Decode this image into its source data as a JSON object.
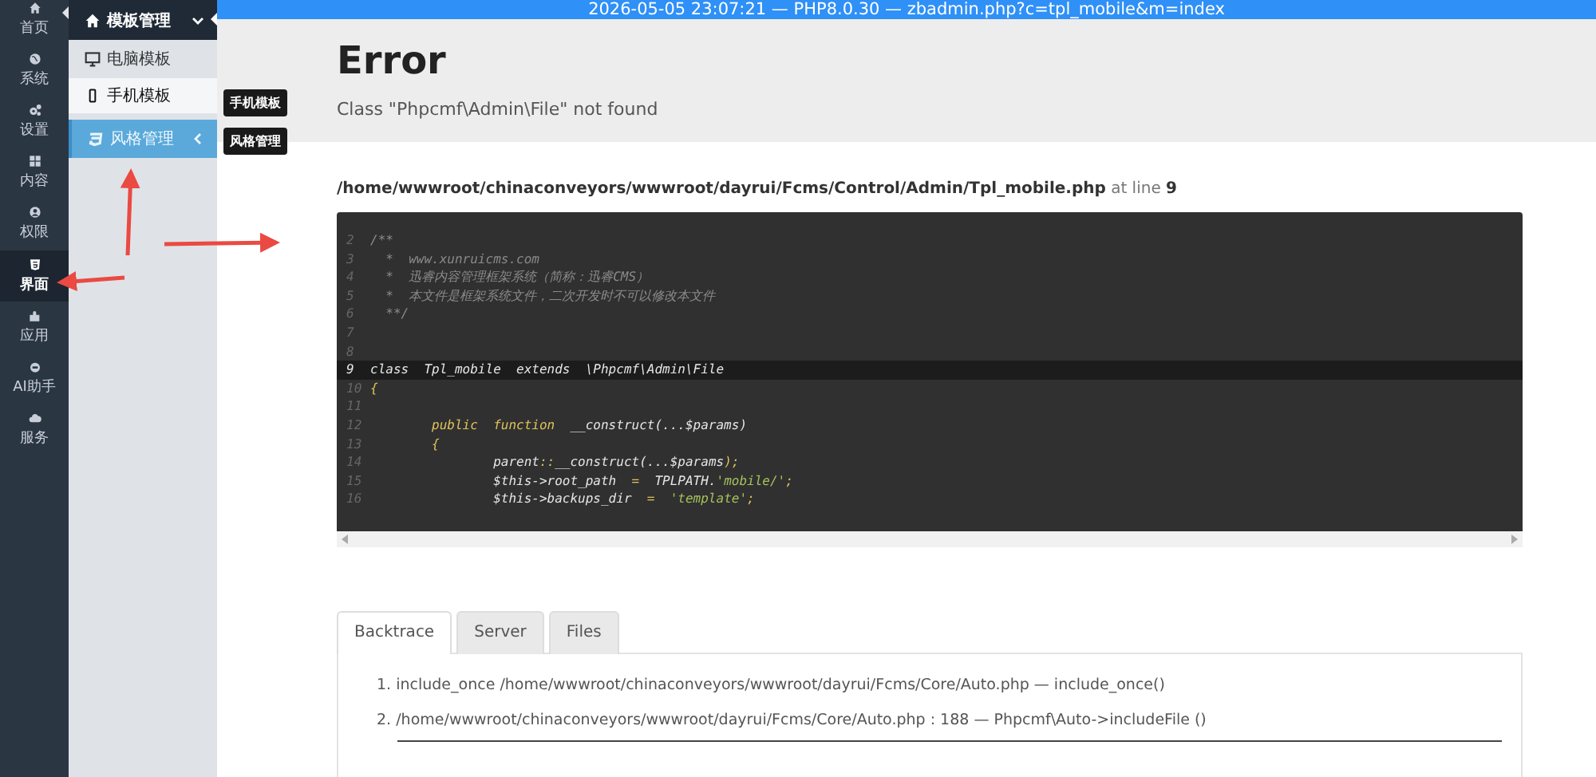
{
  "rail": [
    {
      "label": "首页",
      "selected": false
    },
    {
      "label": "系统",
      "selected": false
    },
    {
      "label": "设置",
      "selected": false
    },
    {
      "label": "内容",
      "selected": false
    },
    {
      "label": "权限",
      "selected": false
    },
    {
      "label": "界面",
      "selected": true
    },
    {
      "label": "应用",
      "selected": false
    },
    {
      "label": "AI助手",
      "selected": false
    },
    {
      "label": "服务",
      "selected": false
    }
  ],
  "submenu": [
    {
      "kind": "header",
      "label": "模板管理",
      "expanded": true
    },
    {
      "kind": "item",
      "label": "电脑模板",
      "selected": false
    },
    {
      "kind": "item",
      "label": "手机模板",
      "selected": true
    },
    {
      "kind": "group",
      "label": "风格管理",
      "expanded": false
    }
  ],
  "tooltips": [
    "手机模板",
    "风格管理"
  ],
  "top_bar": "2026-05-05 23:07:21 — PHP8.0.30 — zbadmin.php?c=tpl_mobile&m=index",
  "error": {
    "title": "Error",
    "message": "Class \"Phpcmf\\Admin\\File\" not found"
  },
  "location": {
    "file": "/home/wwwroot/chinaconveyors/wwwroot/dayrui/Fcms/Control/Admin/Tpl_mobile.php",
    "at": "at line",
    "line": "9"
  },
  "code_lines": [
    {
      "num": "2",
      "highlighted": false,
      "parts": [
        {
          "kind": "comment",
          "text": "/**"
        }
      ]
    },
    {
      "num": "3",
      "highlighted": false,
      "parts": [
        {
          "kind": "comment",
          "text": "  *  www.xunruicms.com"
        }
      ]
    },
    {
      "num": "4",
      "highlighted": false,
      "parts": [
        {
          "kind": "comment",
          "text": "  *  迅睿内容管理框架系统（简称：迅睿CMS）"
        }
      ]
    },
    {
      "num": "5",
      "highlighted": false,
      "parts": [
        {
          "kind": "comment",
          "text": "  *  本文件是框架系统文件，二次开发时不可以修改本文件"
        }
      ]
    },
    {
      "num": "6",
      "highlighted": false,
      "parts": [
        {
          "kind": "comment",
          "text": "  **/"
        }
      ]
    },
    {
      "num": "7",
      "highlighted": false
    },
    {
      "num": "8",
      "highlighted": false
    },
    {
      "num": "9",
      "highlighted": true,
      "parts": [
        {
          "kind": "plain",
          "text": "class  Tpl_mobile  extends  \\Phpcmf\\Admin\\File"
        }
      ]
    },
    {
      "num": "10",
      "highlighted": false,
      "parts": [
        {
          "kind": "keyword",
          "text": "{"
        }
      ]
    },
    {
      "num": "11",
      "highlighted": false
    },
    {
      "num": "12",
      "highlighted": false,
      "parts": [
        {
          "kind": "keyword",
          "text": "        public  function"
        },
        {
          "kind": "plain",
          "text": "  __construct(...$params)"
        }
      ]
    },
    {
      "num": "13",
      "highlighted": false,
      "parts": [
        {
          "kind": "keyword",
          "text": "        {"
        }
      ]
    },
    {
      "num": "14",
      "highlighted": false,
      "parts": [
        {
          "kind": "plain",
          "text": "                parent"
        },
        {
          "kind": "keyword",
          "text": "::"
        },
        {
          "kind": "plain",
          "text": "__construct(...$params"
        },
        {
          "kind": "keyword",
          "text": ");"
        }
      ]
    },
    {
      "num": "15",
      "highlighted": false,
      "parts": [
        {
          "kind": "plain",
          "text": "                $this->root_path  "
        },
        {
          "kind": "keyword",
          "text": "="
        },
        {
          "kind": "plain",
          "text": "  TPLPATH."
        },
        {
          "kind": "string",
          "text": "'mobile/'"
        },
        {
          "kind": "keyword",
          "text": ";"
        }
      ]
    },
    {
      "num": "16",
      "highlighted": false,
      "parts": [
        {
          "kind": "plain",
          "text": "                $this->backups_dir  "
        },
        {
          "kind": "keyword",
          "text": "="
        },
        {
          "kind": "string",
          "text": "  'template'"
        },
        {
          "kind": "keyword",
          "text": ";"
        }
      ]
    }
  ],
  "tabs": [
    {
      "label": "Backtrace",
      "selected": true
    },
    {
      "label": "Server",
      "selected": false
    },
    {
      "label": "Files",
      "selected": false
    }
  ],
  "backtrace": [
    {
      "num": "1.",
      "text": "include_once /home/wwwroot/chinaconveyors/wwwroot/dayrui/Fcms/Core/Auto.php   —   include_once()"
    },
    {
      "num": "2.",
      "text": "/home/wwwroot/chinaconveyors/wwwroot/dayrui/Fcms/Core/Auto.php : 188   —  Phpcmf\\Auto->includeFile ()"
    }
  ]
}
